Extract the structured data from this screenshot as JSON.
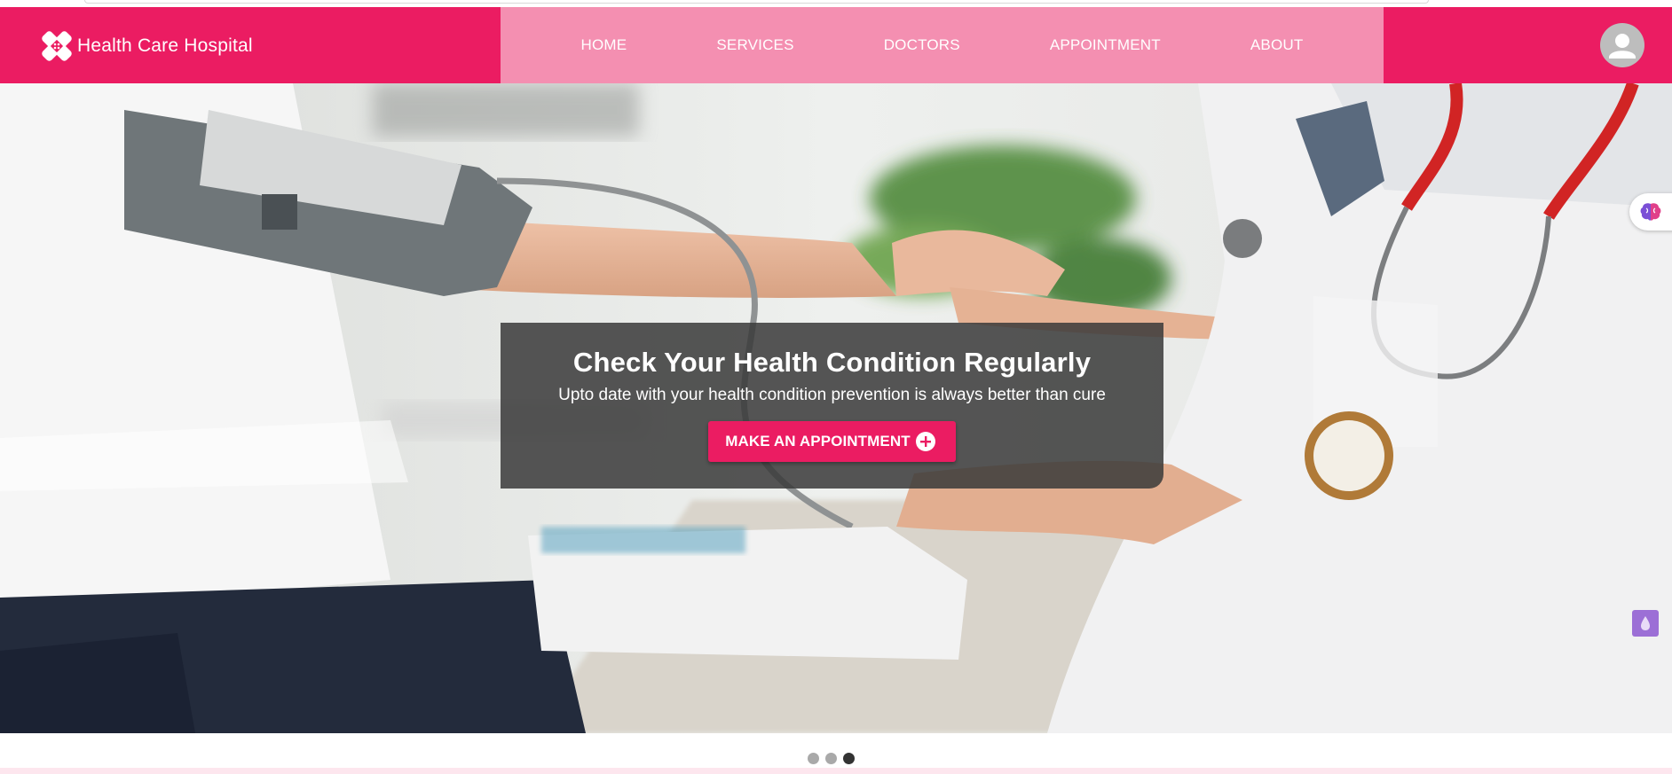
{
  "brand": {
    "name": "Health Care Hospital",
    "logo_icon": "bandage-cross-icon"
  },
  "nav": {
    "links": [
      {
        "label": "HOME"
      },
      {
        "label": "SERVICES"
      },
      {
        "label": "DOCTORS"
      },
      {
        "label": "APPOINTMENT"
      },
      {
        "label": "ABOUT"
      }
    ],
    "avatar_icon": "user-avatar-icon"
  },
  "hero": {
    "title": "Check Your Health Condition Regularly",
    "subtitle": "Upto date with your health condition prevention is always better than cure",
    "button_label": "MAKE AN APPOINTMENT",
    "button_icon": "plus-circle-icon",
    "image_icon": "doctor-blood-pressure-photo"
  },
  "carousel": {
    "slide_count": 3,
    "active_index": 2
  },
  "widgets": {
    "side_tab_icon": "brain-icon",
    "corner_icon": "drop-icon"
  },
  "colors": {
    "primary": "#eb1c62",
    "nav_highlight": "#f48fb1",
    "caption_bg": "#3a3a3a",
    "dot_active": "#333333",
    "dot_inactive": "#a9a9a9"
  }
}
